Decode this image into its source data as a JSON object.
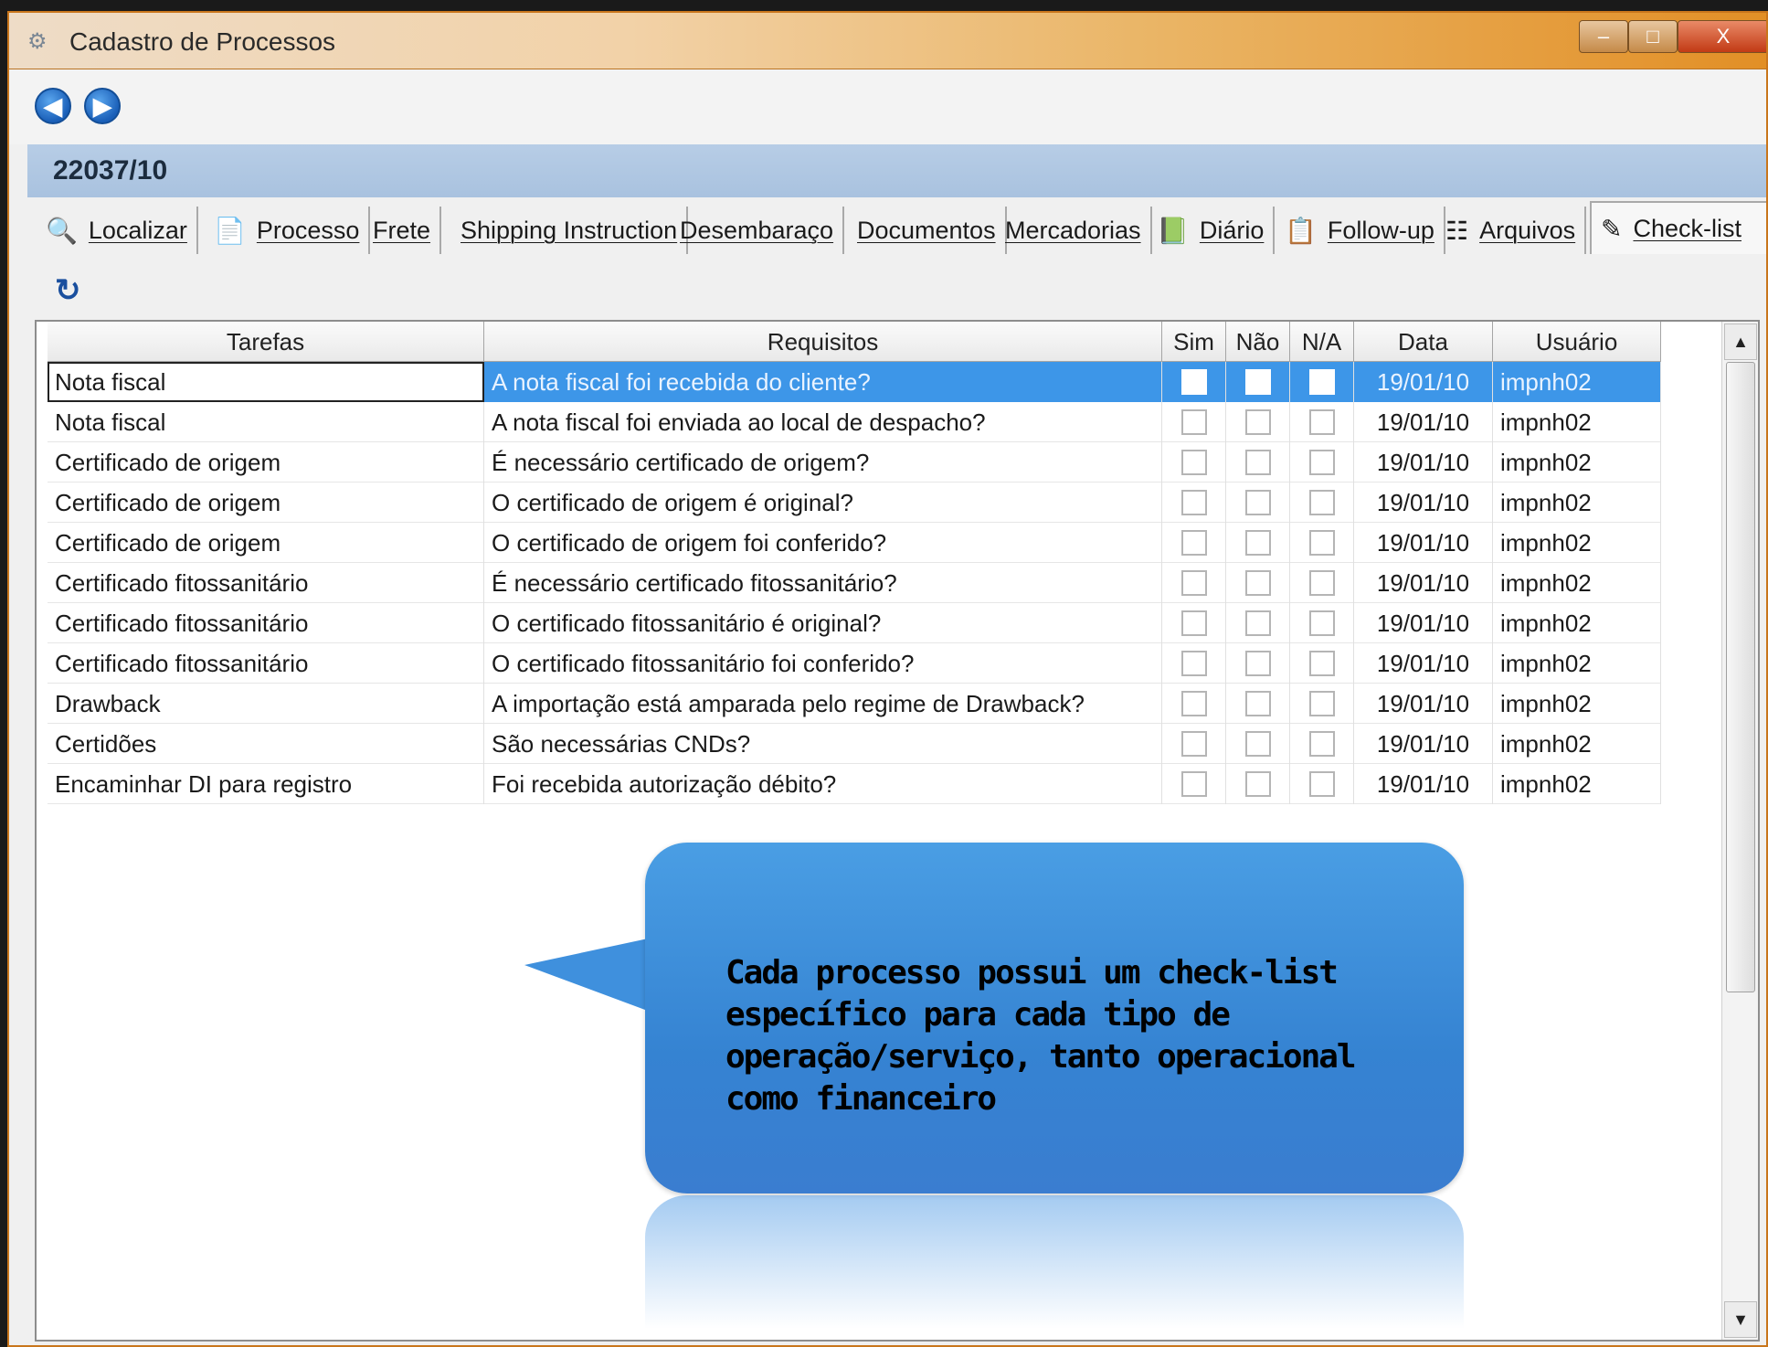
{
  "window": {
    "title": "Cadastro de Processos",
    "controls": {
      "minimize": "–",
      "maximize": "□",
      "close": "X"
    }
  },
  "nav": {
    "back_icon": "◀",
    "forward_icon": "▶"
  },
  "process": {
    "number": "22037/10"
  },
  "tabs": [
    {
      "label": "Localizar",
      "icon": "search-icon",
      "glyph": "🔍"
    },
    {
      "label": "Processo",
      "icon": "document-icon",
      "glyph": "📄"
    },
    {
      "label": "Frete",
      "icon": "",
      "glyph": ""
    },
    {
      "label": "Shipping Instruction",
      "icon": "",
      "glyph": ""
    },
    {
      "label": "Desembaraço",
      "icon": "",
      "glyph": ""
    },
    {
      "label": "Documentos",
      "icon": "",
      "glyph": ""
    },
    {
      "label": "Mercadorias",
      "icon": "",
      "glyph": ""
    },
    {
      "label": "Diário",
      "icon": "diary-icon",
      "glyph": "📗"
    },
    {
      "label": "Follow-up",
      "icon": "followup-icon",
      "glyph": "📋"
    },
    {
      "label": "Arquivos",
      "icon": "files-icon",
      "glyph": "☷"
    },
    {
      "label": "Check-list",
      "icon": "checklist-icon",
      "glyph": "✎"
    }
  ],
  "active_tab": "Check-list",
  "grid": {
    "headers": [
      "Tarefas",
      "Requisitos",
      "Sim",
      "Não",
      "N/A",
      "Data",
      "Usuário"
    ],
    "rows": [
      {
        "tarefa": "Nota fiscal",
        "requisito": "A nota fiscal foi recebida do cliente?",
        "data": "19/01/10",
        "usuario": "impnh02",
        "selected": true
      },
      {
        "tarefa": "Nota fiscal",
        "requisito": "A nota fiscal foi enviada ao local de despacho?",
        "data": "19/01/10",
        "usuario": "impnh02"
      },
      {
        "tarefa": "Certificado de origem",
        "requisito": "É necessário certificado de origem?",
        "data": "19/01/10",
        "usuario": "impnh02"
      },
      {
        "tarefa": "Certificado de origem",
        "requisito": "O certificado de origem é original?",
        "data": "19/01/10",
        "usuario": "impnh02"
      },
      {
        "tarefa": "Certificado de origem",
        "requisito": "O certificado de origem foi conferido?",
        "data": "19/01/10",
        "usuario": "impnh02"
      },
      {
        "tarefa": "Certificado fitossanitário",
        "requisito": "É necessário certificado fitossanitário?",
        "data": "19/01/10",
        "usuario": "impnh02"
      },
      {
        "tarefa": "Certificado fitossanitário",
        "requisito": "O certificado fitossanitário é original?",
        "data": "19/01/10",
        "usuario": "impnh02"
      },
      {
        "tarefa": "Certificado fitossanitário",
        "requisito": "O certificado fitossanitário foi conferido?",
        "data": "19/01/10",
        "usuario": "impnh02"
      },
      {
        "tarefa": "Drawback",
        "requisito": "A importação está amparada pelo regime de Drawback?",
        "data": "19/01/10",
        "usuario": "impnh02"
      },
      {
        "tarefa": "Certidões",
        "requisito": "São necessárias CNDs?",
        "data": "19/01/10",
        "usuario": "impnh02"
      },
      {
        "tarefa": "Encaminhar DI para registro",
        "requisito": "Foi recebida autorização débito?",
        "data": "19/01/10",
        "usuario": "impnh02"
      }
    ]
  },
  "callout": {
    "text": "Cada processo possui um check-list específico para cada tipo de operação/serviço, tanto operacional como financeiro"
  },
  "colors": {
    "selection": "#3d96e8",
    "process_bar": "#b7cde6",
    "callout": "#3583d2",
    "titlebar_accent": "#e28f26"
  }
}
